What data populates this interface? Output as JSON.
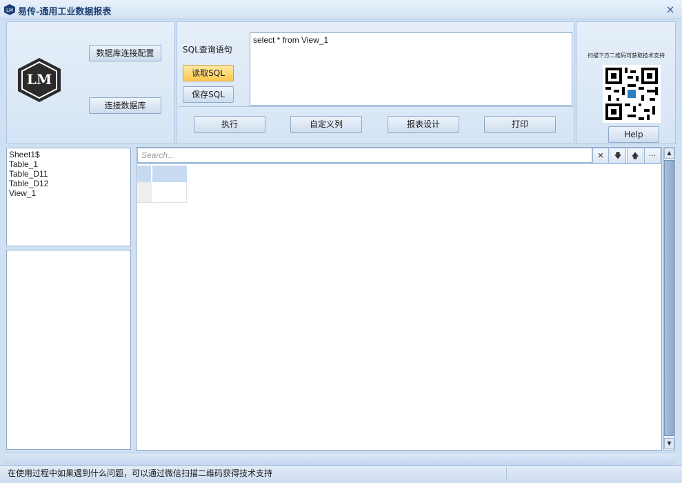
{
  "window": {
    "title": "易传-通用工业数据报表",
    "close_glyph": "×"
  },
  "left_panel": {
    "db_config_label": "数据库连接配置",
    "connect_label": "连接数据库",
    "logo_text": "LM"
  },
  "sql_panel": {
    "label": "SQL查询语句",
    "read_label": "读取SQL",
    "save_label": "保存SQL",
    "query": "select * from View_1",
    "execute_label": "执行",
    "custom_columns_label": "自定义列",
    "report_design_label": "报表设计",
    "print_label": "打印"
  },
  "right_panel": {
    "qr_caption": "扫描下方二维码可获取技术支持",
    "help_label": "Help"
  },
  "tables": [
    "Sheet1$",
    "Table_1",
    "Table_D11",
    "Table_D12",
    "View_1"
  ],
  "grid": {
    "search_placeholder": "Search...",
    "clear_glyph": "✕",
    "down_glyph": "🡇",
    "up_glyph": "🡅",
    "more_glyph": "···"
  },
  "statusbar": {
    "message": "在使用过程中如果遇到什么问题，可以通过微信扫描二维码获得技术支持"
  },
  "colors": {
    "accent": "#ffc84d",
    "panel": "#d5e4f5",
    "border": "#a9c3e3"
  }
}
